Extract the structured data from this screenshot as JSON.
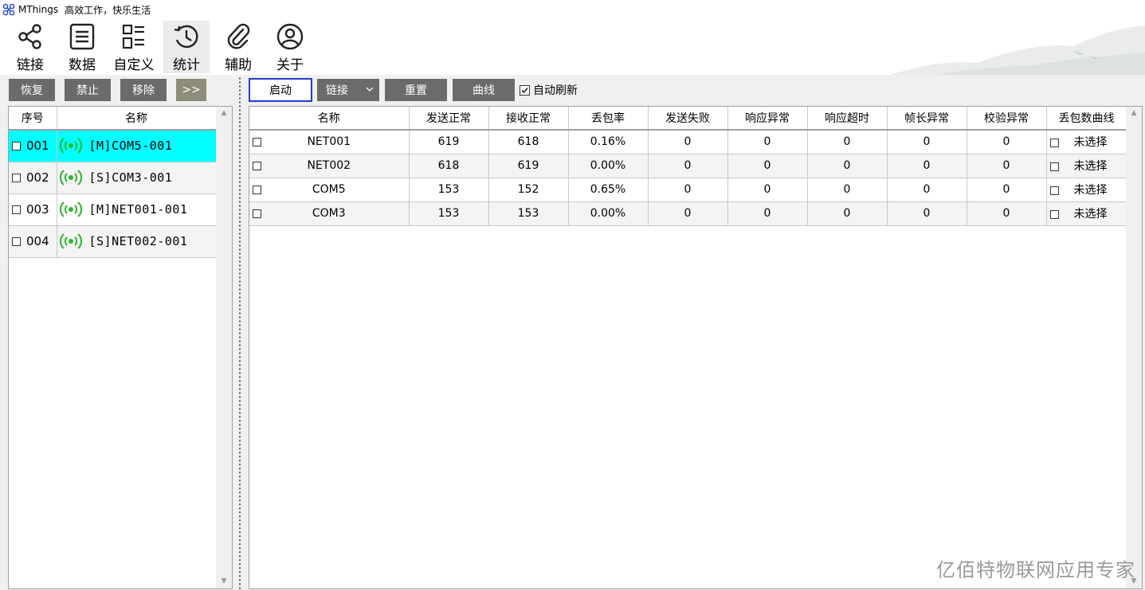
{
  "titlebar": {
    "app_name": "MThings",
    "slogan": "高效工作，快乐生活"
  },
  "toolbar": {
    "items": [
      {
        "label": "链接",
        "icon": "share-icon"
      },
      {
        "label": "数据",
        "icon": "list-icon"
      },
      {
        "label": "自定义",
        "icon": "grid-list-icon"
      },
      {
        "label": "统计",
        "icon": "clock-history-icon",
        "active": true
      },
      {
        "label": "辅助",
        "icon": "paperclip-icon"
      },
      {
        "label": "关于",
        "icon": "user-icon"
      }
    ]
  },
  "left": {
    "buttons": {
      "restore": "恢复",
      "disable": "禁止",
      "remove": "移除",
      "more": ">>"
    },
    "headers": {
      "seq": "序号",
      "name": "名称"
    },
    "rows": [
      {
        "seq": "001",
        "name": "[M]COM5-001",
        "selected": true
      },
      {
        "seq": "002",
        "name": "[S]COM3-001"
      },
      {
        "seq": "003",
        "name": "[M]NET001-001"
      },
      {
        "seq": "004",
        "name": "[S]NET002-001"
      }
    ]
  },
  "right": {
    "buttons": {
      "start": "启动",
      "link": "链接",
      "reset": "重置",
      "curve": "曲线"
    },
    "auto_refresh": "自动刷新",
    "auto_refresh_checked": true,
    "headers": [
      "名称",
      "发送正常",
      "接收正常",
      "丢包率",
      "发送失败",
      "响应异常",
      "响应超时",
      "帧长异常",
      "校验异常",
      "丢包数曲线"
    ],
    "rows": [
      [
        "NET001",
        "619",
        "618",
        "0.16%",
        "0",
        "0",
        "0",
        "0",
        "0",
        "未选择"
      ],
      [
        "NET002",
        "618",
        "619",
        "0.00%",
        "0",
        "0",
        "0",
        "0",
        "0",
        "未选择"
      ],
      [
        "COM5",
        "153",
        "152",
        "0.65%",
        "0",
        "0",
        "0",
        "0",
        "0",
        "未选择"
      ],
      [
        "COM3",
        "153",
        "153",
        "0.00%",
        "0",
        "0",
        "0",
        "0",
        "0",
        "未选择"
      ]
    ]
  },
  "watermark": "亿佰特物联网应用专家",
  "colors": {
    "selected_row": "#00ffff",
    "signal_icon": "#2bb52b",
    "button_gray": "#6b6b6b",
    "start_border": "#1e3fd0"
  }
}
